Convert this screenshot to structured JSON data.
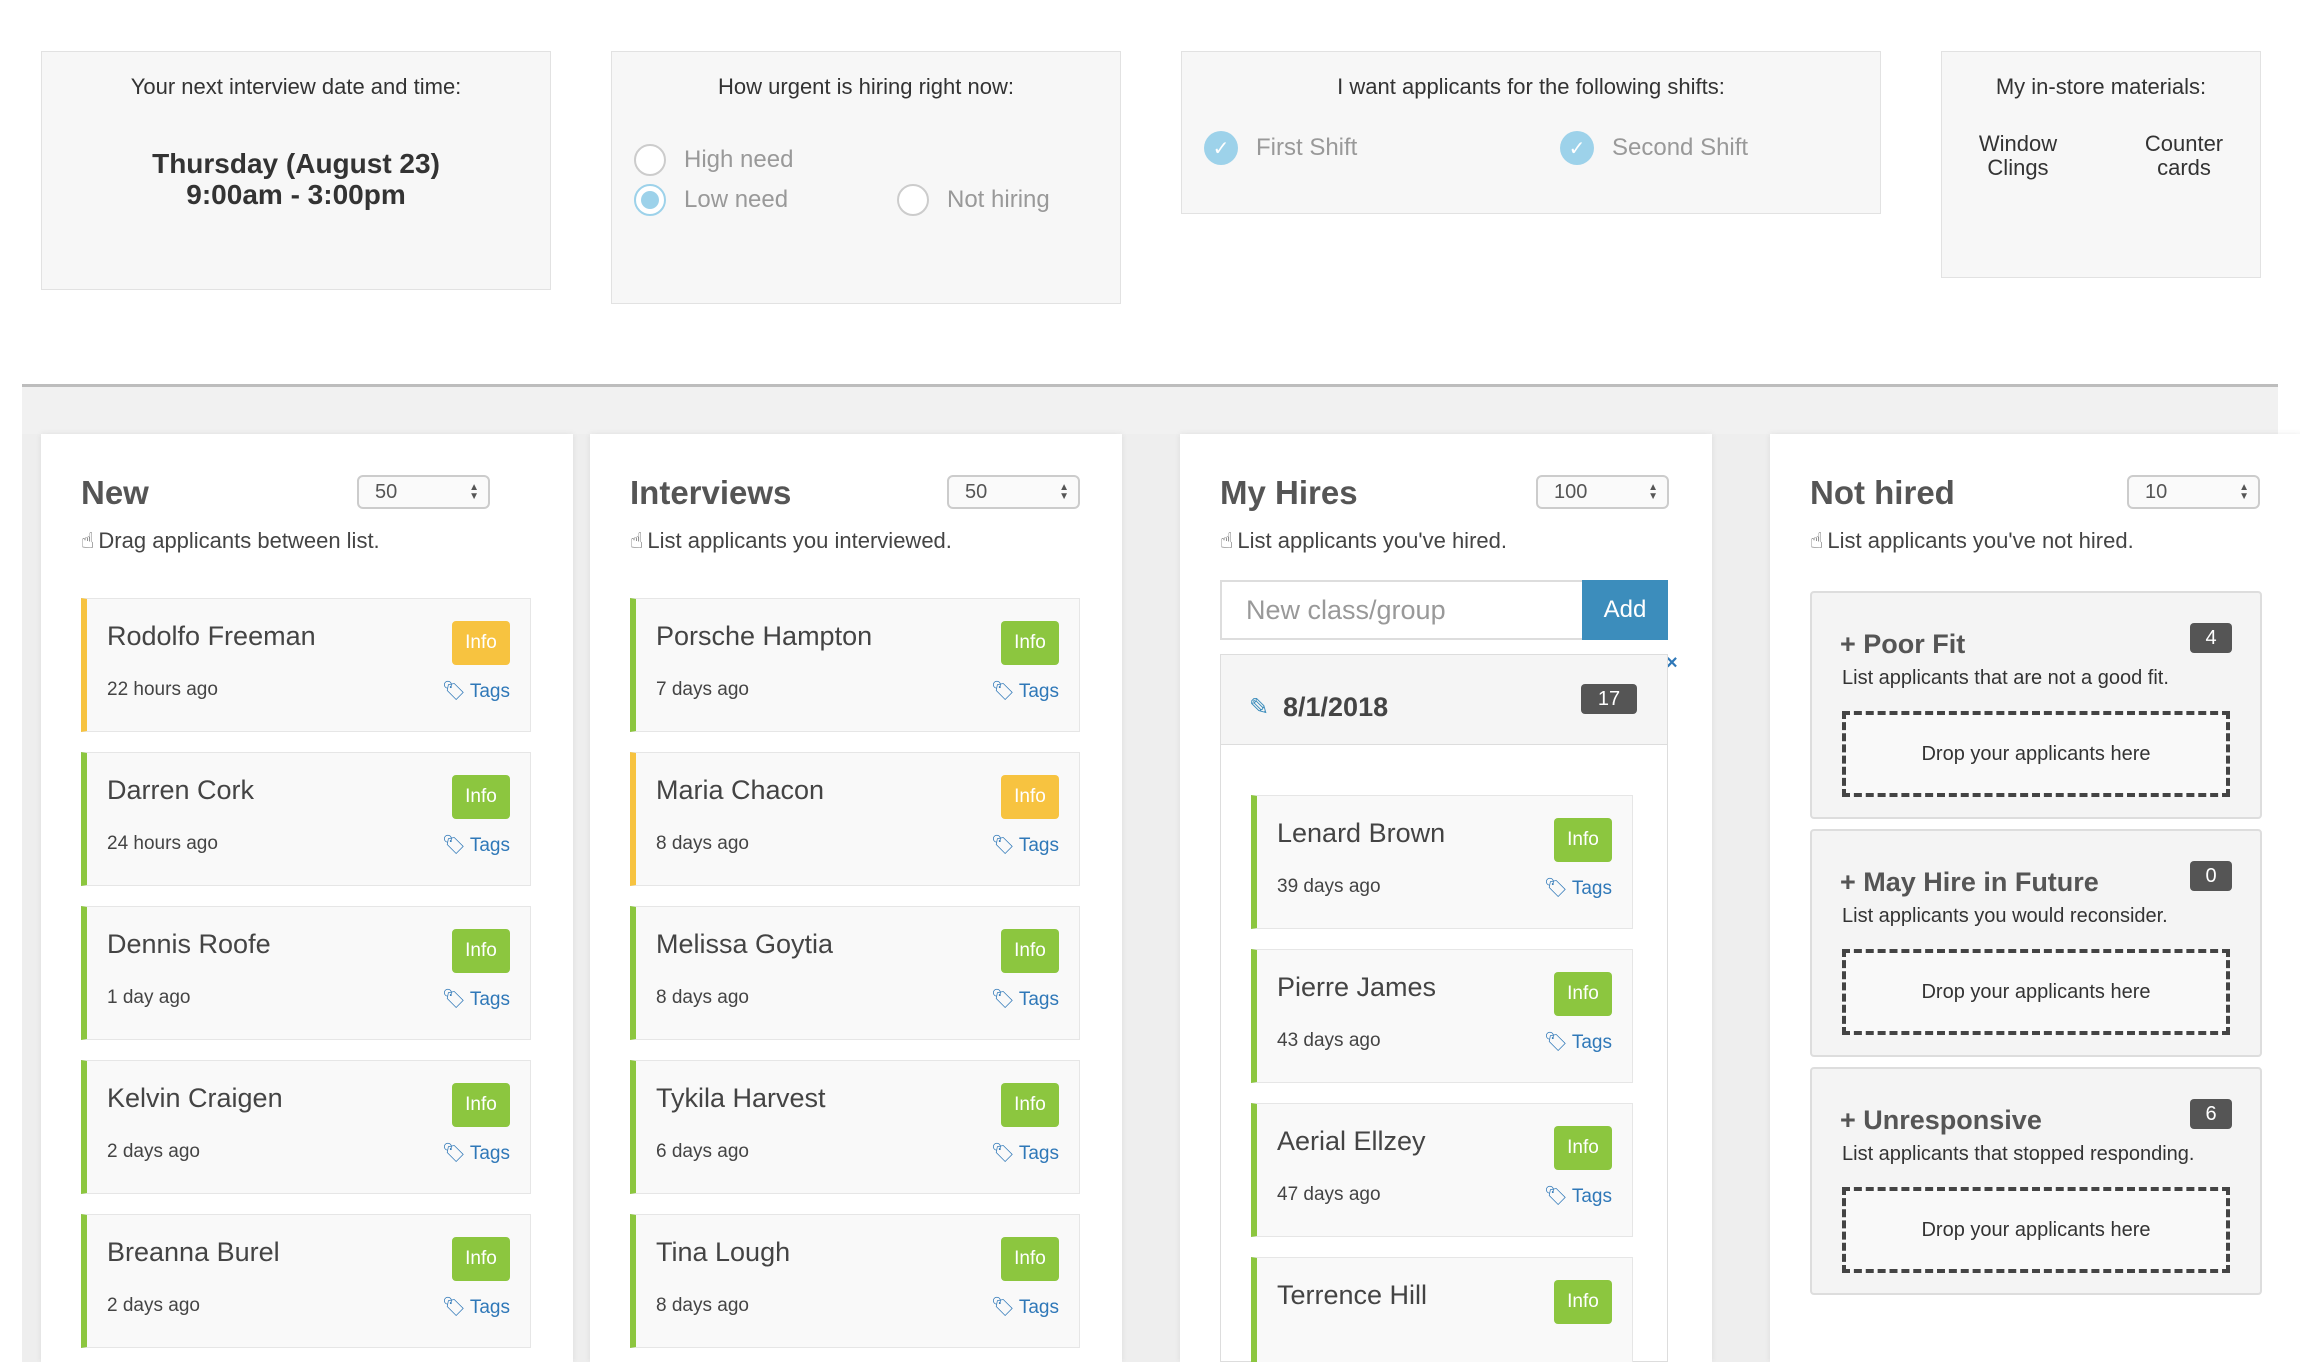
{
  "top": {
    "interview": {
      "title": "Your next interview date and time:",
      "line1": "Thursday (August 23)",
      "line2": "9:00am - 3:00pm"
    },
    "urgency": {
      "title": "How urgent is hiring right now:",
      "options": [
        {
          "label": "High need",
          "selected": false
        },
        {
          "label": "Low need",
          "selected": true
        },
        {
          "label": "Not hiring",
          "selected": false
        }
      ]
    },
    "shifts": {
      "title": "I want applicants for the following shifts:",
      "options": [
        {
          "label": "First Shift",
          "checked": true
        },
        {
          "label": "Second Shift",
          "checked": true
        }
      ]
    },
    "materials": {
      "title": "My in-store materials:",
      "items": [
        "Window\nClings",
        "Counter\ncards"
      ]
    }
  },
  "columns": [
    {
      "title": "New",
      "select": "50",
      "subtitle": "Drag applicants between list.",
      "cards": [
        {
          "name": "Rodolfo Freeman",
          "ago": "22 hours ago",
          "info": "Info",
          "tags": "Tags",
          "status": "yellow"
        },
        {
          "name": "Darren Cork",
          "ago": "24 hours ago",
          "info": "Info",
          "tags": "Tags",
          "status": "green"
        },
        {
          "name": "Dennis Roofe",
          "ago": "1 day ago",
          "info": "Info",
          "tags": "Tags",
          "status": "green"
        },
        {
          "name": "Kelvin Craigen",
          "ago": "2 days ago",
          "info": "Info",
          "tags": "Tags",
          "status": "green"
        },
        {
          "name": "Breanna Burel",
          "ago": "2 days ago",
          "info": "Info",
          "tags": "Tags",
          "status": "green"
        }
      ]
    },
    {
      "title": "Interviews",
      "select": "50",
      "subtitle": "List applicants you interviewed.",
      "cards": [
        {
          "name": "Porsche Hampton",
          "ago": "7 days ago",
          "info": "Info",
          "tags": "Tags",
          "status": "green"
        },
        {
          "name": "Maria Chacon",
          "ago": "8 days ago",
          "info": "Info",
          "tags": "Tags",
          "status": "yellow"
        },
        {
          "name": "Melissa Goytia",
          "ago": "8 days ago",
          "info": "Info",
          "tags": "Tags",
          "status": "green"
        },
        {
          "name": "Tykila Harvest",
          "ago": "6 days ago",
          "info": "Info",
          "tags": "Tags",
          "status": "green"
        },
        {
          "name": "Tina Lough",
          "ago": "8 days ago",
          "info": "Info",
          "tags": "Tags",
          "status": "green"
        }
      ]
    },
    {
      "title": "My Hires",
      "select": "100",
      "subtitle": "List applicants you've hired.",
      "new_group_placeholder": "New class/group",
      "add_label": "Add",
      "group": {
        "date": "8/1/2018",
        "count": "17",
        "close": "×"
      },
      "cards": [
        {
          "name": "Lenard Brown",
          "ago": "39 days ago",
          "info": "Info",
          "tags": "Tags",
          "status": "green"
        },
        {
          "name": "Pierre James",
          "ago": "43 days ago",
          "info": "Info",
          "tags": "Tags",
          "status": "green"
        },
        {
          "name": "Aerial Ellzey",
          "ago": "47 days ago",
          "info": "Info",
          "tags": "Tags",
          "status": "green"
        },
        {
          "name": "Terrence Hill",
          "ago": "",
          "info": "Info",
          "tags": "",
          "status": "green"
        }
      ]
    },
    {
      "title": "Not hired",
      "select": "10",
      "subtitle": "List applicants you've not hired.",
      "categories": [
        {
          "title": "Poor Fit",
          "desc": "List applicants that are not a good fit.",
          "count": "4",
          "drop": "Drop your applicants here"
        },
        {
          "title": "May Hire in Future",
          "desc": "List applicants you would reconsider.",
          "count": "0",
          "drop": "Drop your applicants here"
        },
        {
          "title": "Unresponsive",
          "desc": "List applicants that stopped responding.",
          "count": "6",
          "drop": "Drop your applicants here"
        }
      ]
    }
  ],
  "colors": {
    "green": "#8cc63f",
    "yellow": "#f7c340",
    "blue": "#3c8dbc",
    "radio": "#9dd2ea"
  }
}
